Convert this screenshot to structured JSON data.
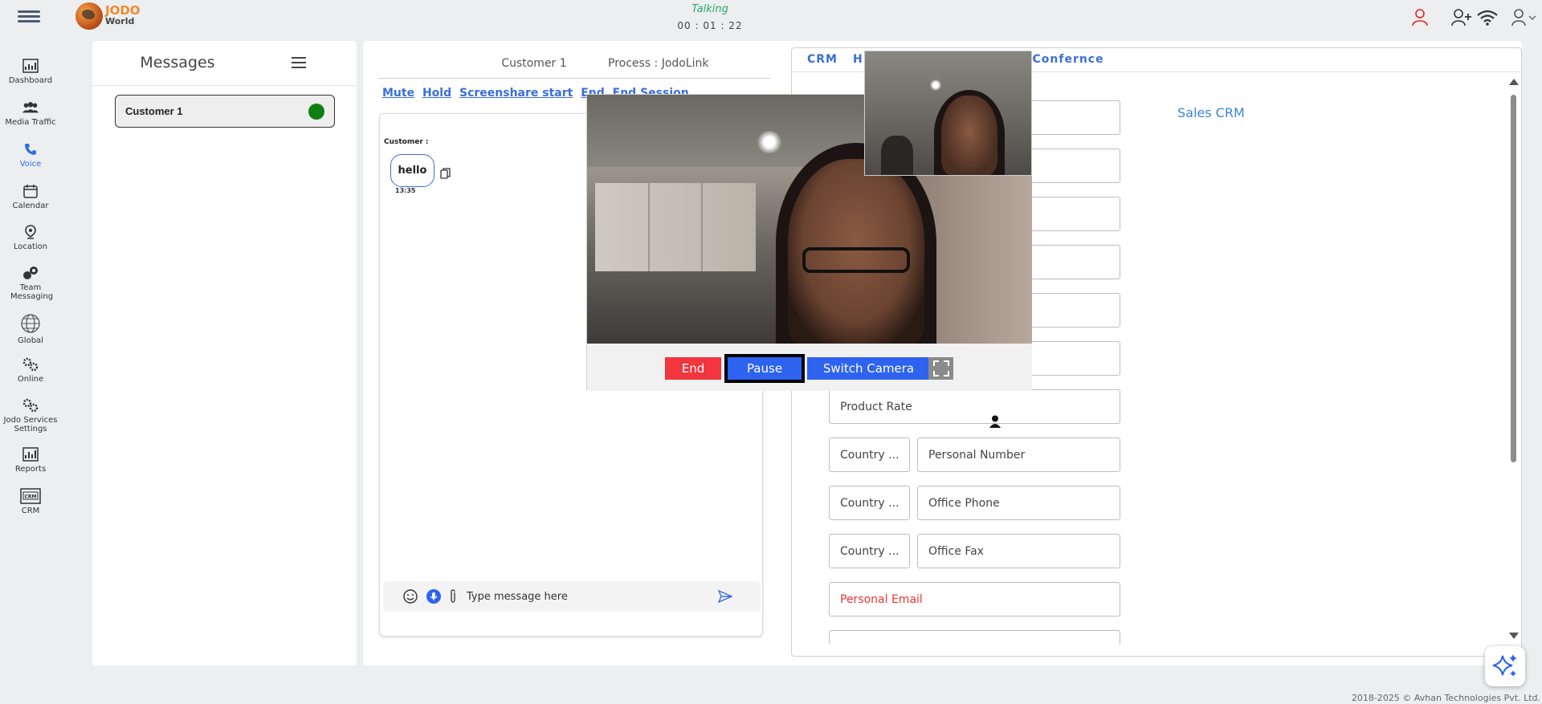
{
  "topbar": {
    "logo_line1": "JODO",
    "logo_line2": "World",
    "call_status": "Talking",
    "call_timer": "00 : 01 : 22"
  },
  "nav": {
    "items": [
      {
        "label": "Dashboard",
        "icon": "dashboard-icon"
      },
      {
        "label": "Media Traffic",
        "icon": "users-icon"
      },
      {
        "label": "Voice",
        "icon": "phone-icon"
      },
      {
        "label": "Calendar",
        "icon": "calendar-icon"
      },
      {
        "label": "Location",
        "icon": "location-icon"
      },
      {
        "label": "Team Messaging",
        "icon": "team-messaging-icon"
      },
      {
        "label": "Global",
        "icon": "globe-icon"
      },
      {
        "label": "Online",
        "icon": "gears-icon"
      },
      {
        "label": "Jodo Services Settings",
        "icon": "gears-icon"
      },
      {
        "label": "Reports",
        "icon": "reports-icon"
      },
      {
        "label": "CRM",
        "icon": "crm-icon"
      }
    ]
  },
  "messages": {
    "title": "Messages",
    "customer": "Customer 1"
  },
  "chat": {
    "header_customer": "Customer 1",
    "header_process": "Process : JodoLink",
    "actions": {
      "mute": "Mute",
      "hold": "Hold",
      "screenshare": "Screenshare start",
      "end": "End",
      "end_session": "End Session"
    },
    "message": {
      "sender": "Customer :",
      "text": "hello",
      "time": "13:35"
    },
    "composer_placeholder": "Type message here"
  },
  "crm": {
    "tabs": {
      "crm": "CRM",
      "h": "H",
      "conference": "o Confernce"
    },
    "title": "Sales CRM",
    "fields": {
      "product_rate": "Product Rate",
      "country": "Country ...",
      "personal_number": "Personal Number",
      "office_phone": "Office Phone",
      "office_fax": "Office Fax",
      "personal_email": "Personal Email"
    }
  },
  "video": {
    "end_label": "End",
    "pause_label": "Pause",
    "switch_label": "Switch Camera"
  },
  "footer": "2018-2025 © Avhan Technologies Pvt. Ltd.",
  "colors": {
    "primary_blue": "#2e63f0",
    "end_red": "#f2353e",
    "online_green": "#0f7f12",
    "talking_green": "#2aa86a",
    "logo_orange": "#f08a2c"
  }
}
